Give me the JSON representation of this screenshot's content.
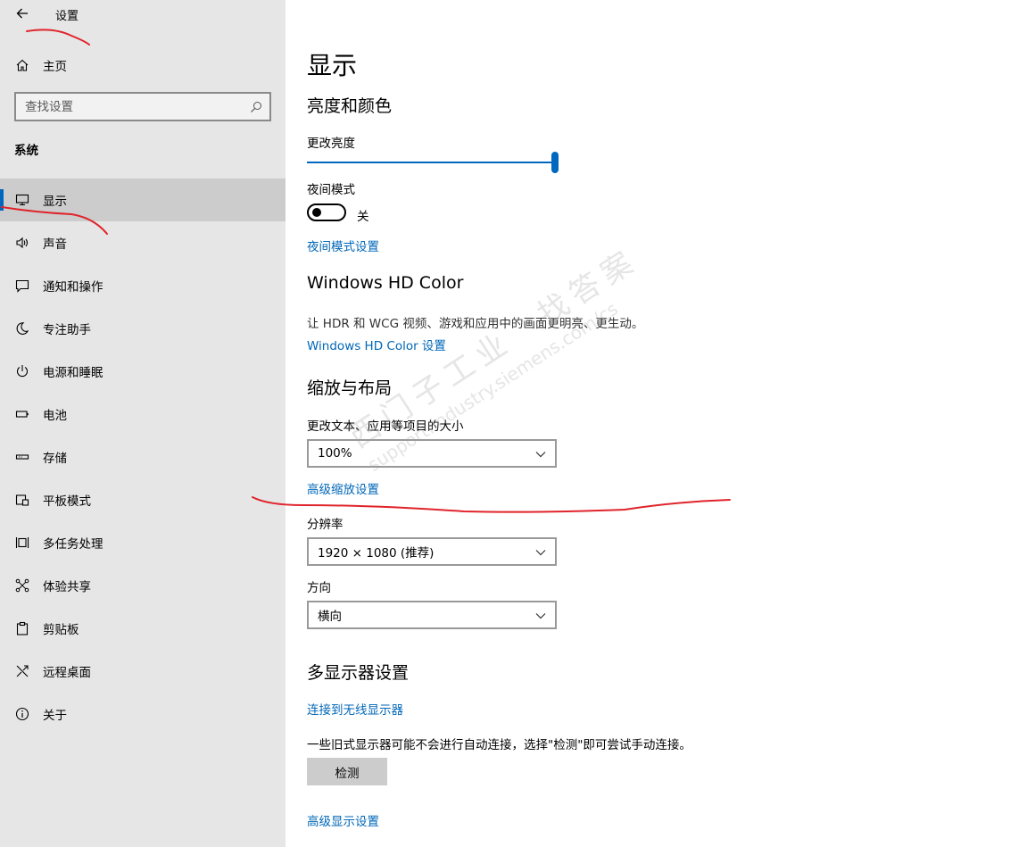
{
  "window": {
    "title": "设置"
  },
  "sidebar": {
    "home_label": "主页",
    "search": {
      "placeholder": "查找设置"
    },
    "section_header": "系统",
    "items": [
      {
        "label": "显示",
        "icon": "monitor-icon",
        "active": true
      },
      {
        "label": "声音",
        "icon": "speaker-icon"
      },
      {
        "label": "通知和操作",
        "icon": "notification-icon"
      },
      {
        "label": "专注助手",
        "icon": "moon-icon"
      },
      {
        "label": "电源和睡眠",
        "icon": "power-icon"
      },
      {
        "label": "电池",
        "icon": "battery-icon"
      },
      {
        "label": "存储",
        "icon": "storage-icon"
      },
      {
        "label": "平板模式",
        "icon": "tablet-icon"
      },
      {
        "label": "多任务处理",
        "icon": "multitask-icon"
      },
      {
        "label": "体验共享",
        "icon": "share-icon"
      },
      {
        "label": "剪贴板",
        "icon": "clipboard-icon"
      },
      {
        "label": "远程桌面",
        "icon": "remote-desktop-icon"
      },
      {
        "label": "关于",
        "icon": "info-icon"
      }
    ]
  },
  "main": {
    "title": "显示",
    "brightness": {
      "heading": "亮度和颜色",
      "slider_label": "更改亮度",
      "brightness_value": 100,
      "night_mode_label": "夜间模式",
      "night_mode_state": "关",
      "night_mode_on": false,
      "night_mode_link": "夜间模式设置"
    },
    "hdr": {
      "heading": "Windows HD Color",
      "description": "让 HDR 和 WCG 视频、游戏和应用中的画面更明亮、更生动。",
      "link": "Windows HD Color 设置"
    },
    "scale": {
      "heading": "缩放与布局",
      "size_label": "更改文本、应用等项目的大小",
      "size_value": "100%",
      "advanced_link": "高级缩放设置",
      "resolution_label": "分辨率",
      "resolution_value": "1920 × 1080 (推荐)",
      "orientation_label": "方向",
      "orientation_value": "横向"
    },
    "multi_display": {
      "heading": "多显示器设置",
      "wireless_link": "连接到无线显示器",
      "description": "一些旧式显示器可能不会进行自动连接，选择\"检测\"即可尝试手动连接。",
      "detect_button": "检测",
      "advanced_link": "高级显示设置"
    }
  },
  "watermark": {
    "line1": "西门子工业　找答案",
    "line2": "support.industry.siemens.com/cs"
  },
  "colors": {
    "accent": "#0067c0",
    "link": "#0067b8",
    "sidebar_bg": "#e6e6e6",
    "active_item_bg": "#cccccc",
    "annotation": "#e0242b"
  }
}
